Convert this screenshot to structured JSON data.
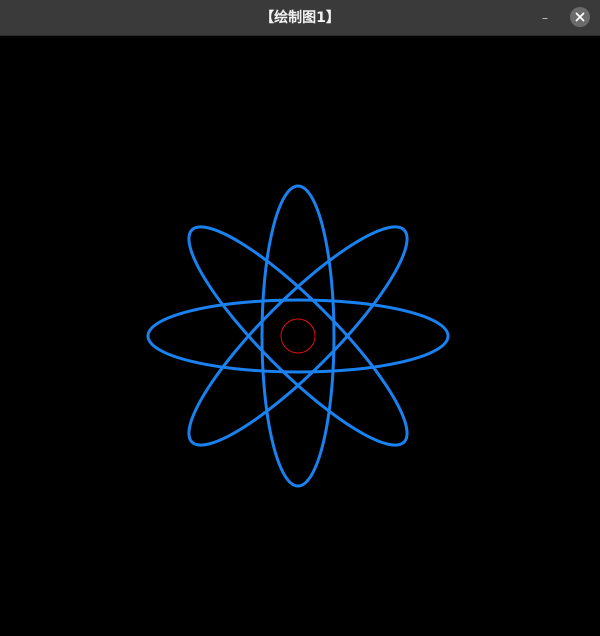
{
  "window": {
    "title": "【绘制图1】",
    "minimize_glyph": "–",
    "minimize_icon": "minimize-icon",
    "close_icon": "close-icon"
  },
  "drawing": {
    "background_color": "#000000",
    "orbit_color": "#1a82f0",
    "nucleus_color": "#e01010",
    "orbit_count": 4,
    "orbit_angles_deg": [
      0,
      45,
      90,
      135
    ]
  }
}
